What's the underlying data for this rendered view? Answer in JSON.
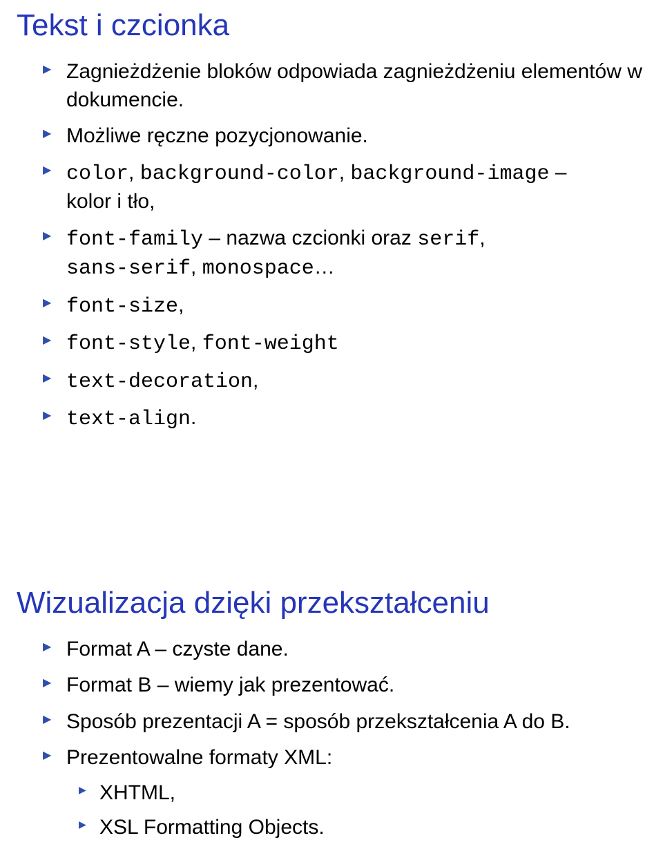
{
  "section1": {
    "title": "Tekst i czcionka",
    "items": [
      {
        "text": "Zagnieżdżenie bloków odpowiada zagnieżdżeniu elementów w dokumencie."
      },
      {
        "text": "Możliwe ręczne pozycjonowanie."
      },
      {
        "code1": "color",
        "sep1": ", ",
        "code2": "background-color",
        "sep2": ", ",
        "code3": "background-image",
        "dash": " –",
        "line2": "kolor i tło,"
      },
      {
        "code1": "font-family",
        "dash": " – nazwa czcionki oraz ",
        "code2": "serif",
        "sep": ",",
        "line2a": "sans-serif",
        "line2sep": ", ",
        "line2b": "monospace",
        "line2tail": "…"
      },
      {
        "code1": "font-size",
        "tail": ","
      },
      {
        "code1": "font-style",
        "sep": ", ",
        "code2": "font-weight"
      },
      {
        "code1": "text-decoration",
        "tail": ","
      },
      {
        "code1": "text-align",
        "tail": "."
      }
    ]
  },
  "section2": {
    "title": "Wizualizacja dzięki przekształceniu",
    "items": [
      {
        "text": "Format A – czyste dane."
      },
      {
        "text": "Format B – wiemy jak prezentować."
      },
      {
        "text": "Sposób prezentacji A = sposób przekształcenia A do B."
      },
      {
        "text": "Prezentowalne formaty XML:",
        "sub": [
          {
            "text": "XHTML,"
          },
          {
            "text": "XSL Formatting Objects."
          }
        ]
      }
    ]
  }
}
